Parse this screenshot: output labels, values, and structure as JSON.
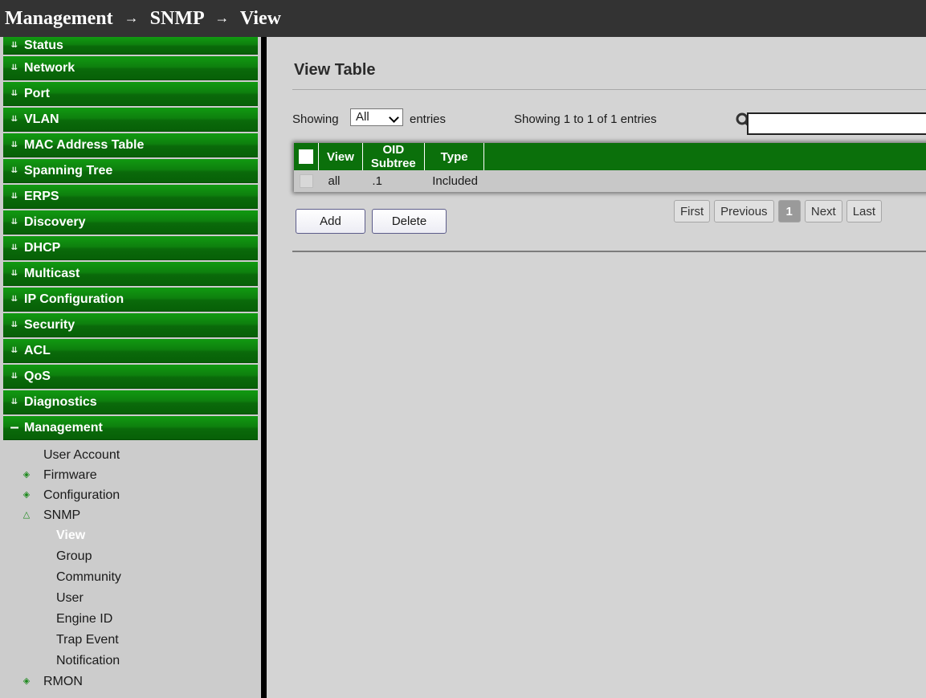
{
  "header": {
    "crumbs": [
      "Management",
      "SNMP",
      "View"
    ],
    "separator": "→"
  },
  "sidebar": {
    "items": [
      {
        "label": "Status"
      },
      {
        "label": "Network"
      },
      {
        "label": "Port"
      },
      {
        "label": "VLAN"
      },
      {
        "label": "MAC Address Table"
      },
      {
        "label": "Spanning Tree"
      },
      {
        "label": "ERPS"
      },
      {
        "label": "Discovery"
      },
      {
        "label": "DHCP"
      },
      {
        "label": "Multicast"
      },
      {
        "label": "IP Configuration"
      },
      {
        "label": "Security"
      },
      {
        "label": "ACL"
      },
      {
        "label": "QoS"
      },
      {
        "label": "Diagnostics"
      },
      {
        "label": "Management"
      }
    ],
    "expanded_toggle": "–",
    "collapsed_icon": "chevron-down-double-icon",
    "management_children": {
      "user_account": "User Account",
      "firmware": "Firmware",
      "configuration": "Configuration",
      "snmp": "SNMP",
      "snmp_children": [
        "View",
        "Group",
        "Community",
        "User",
        "Engine ID",
        "Trap Event",
        "Notification"
      ],
      "rmon": "RMON"
    }
  },
  "main": {
    "heading": "View Table",
    "showing_label": "Showing",
    "page_size": "All",
    "entries_label": "entries",
    "info": "Showing 1 to 1 of 1 entries",
    "search_value": "",
    "table": {
      "columns": [
        "View",
        "OID Subtree",
        "Type"
      ],
      "rows": [
        {
          "view": "all",
          "oid_subtree": ".1",
          "type": "Included"
        }
      ]
    },
    "buttons": {
      "add": "Add",
      "delete": "Delete"
    },
    "pager": {
      "first": "First",
      "previous": "Previous",
      "current": "1",
      "next": "Next",
      "last": "Last"
    }
  },
  "colors": {
    "nav_green": "#0e800e",
    "table_header_green": "#0b700b",
    "title_bar": "#333333",
    "sidebar_bg": "#cccccc",
    "content_bg": "#d4d4d4"
  }
}
